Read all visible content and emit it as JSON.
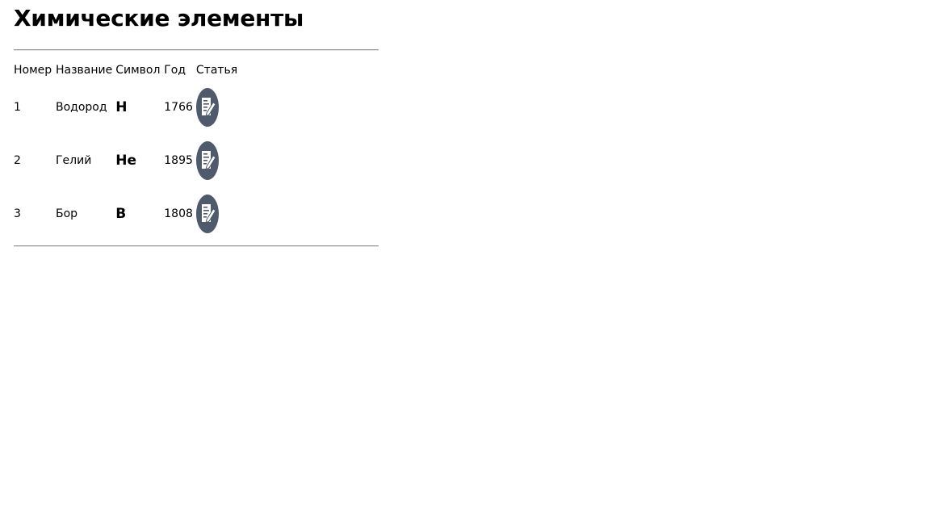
{
  "page": {
    "title": "Химические элементы"
  },
  "table": {
    "headers": {
      "number": "Номер",
      "name": "Название",
      "symbol": "Символ",
      "year": "Год",
      "article": "Статья"
    },
    "rows": [
      {
        "number": "1",
        "name": "Водород",
        "symbol": "H",
        "year": "1766",
        "article_icon": "article-edit-icon"
      },
      {
        "number": "2",
        "name": "Гелий",
        "symbol": "He",
        "year": "1895",
        "article_icon": "article-edit-icon"
      },
      {
        "number": "3",
        "name": "Бор",
        "symbol": "B",
        "year": "1808",
        "article_icon": "article-edit-icon"
      }
    ]
  },
  "colors": {
    "icon_fill": "#4f5b6c",
    "icon_glyph": "#ffffff",
    "rule": "#9a9a9a"
  }
}
